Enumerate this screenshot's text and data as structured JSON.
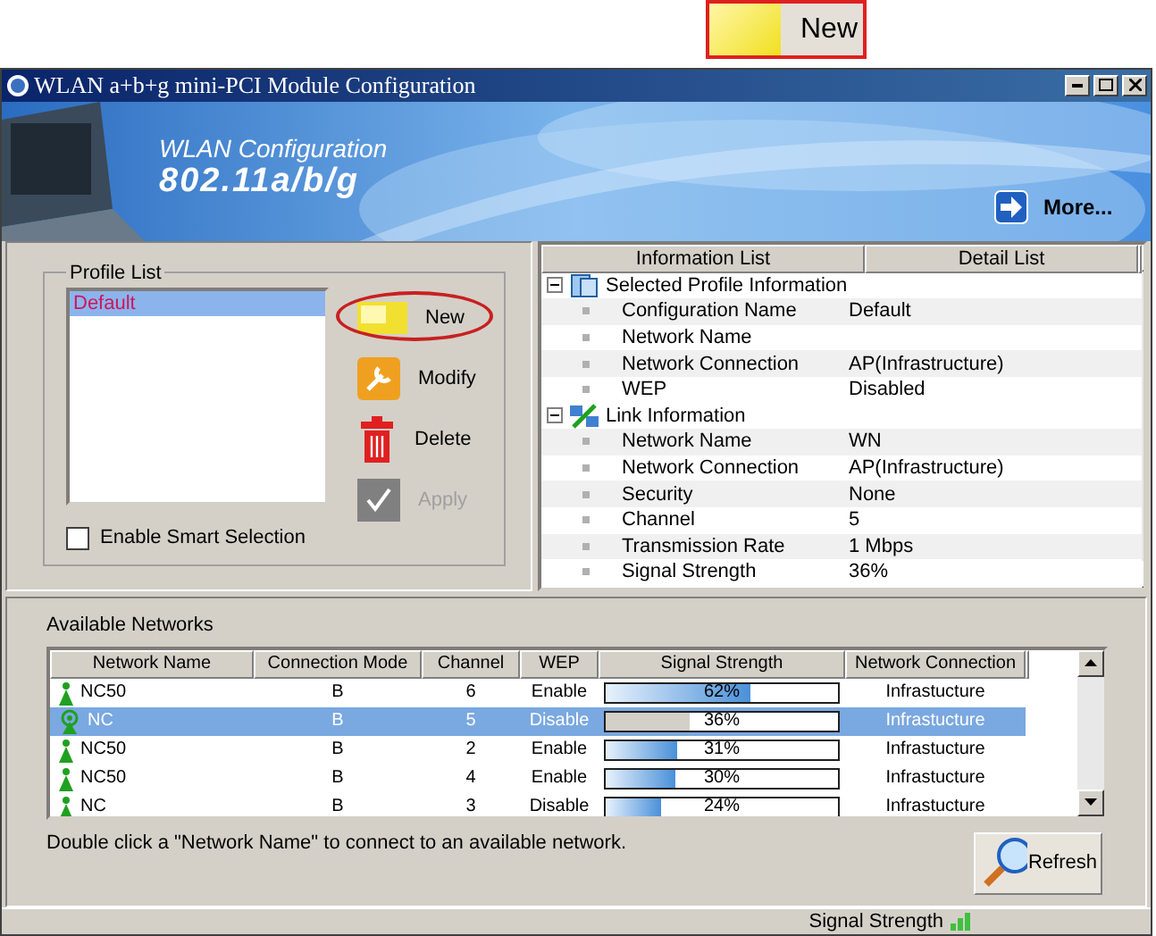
{
  "callout": {
    "label": "New"
  },
  "window": {
    "title": "WLAN a+b+g mini-PCI Module Configuration"
  },
  "banner": {
    "title": "WLAN Configuration",
    "subtitle": "802.11a/b/g",
    "more": "More..."
  },
  "profile_list": {
    "legend": "Profile List",
    "profiles": [
      {
        "name": "Default",
        "selected": true
      }
    ],
    "buttons": [
      {
        "label": "New",
        "kind": "new",
        "disabled": false,
        "highlighted": true
      },
      {
        "label": "Modify",
        "kind": "modify",
        "disabled": false,
        "highlighted": false
      },
      {
        "label": "Delete",
        "kind": "delete",
        "disabled": false,
        "highlighted": false
      },
      {
        "label": "Apply",
        "kind": "apply",
        "disabled": true,
        "highlighted": false
      }
    ],
    "smart_selection": {
      "label": "Enable Smart Selection",
      "checked": false
    }
  },
  "info": {
    "columns": [
      "Information List",
      "Detail List"
    ],
    "sections": [
      {
        "title": "Selected Profile Information",
        "kind": "profile",
        "expanded": true,
        "items": [
          {
            "label": "Configuration Name",
            "value": "Default"
          },
          {
            "label": "Network Name"
          },
          {
            "label": "Network Connection",
            "value": "AP(Infrastructure)"
          },
          {
            "label": "WEP",
            "value": "Disabled"
          }
        ]
      },
      {
        "title": "Link Information",
        "kind": "link",
        "expanded": true,
        "items": [
          {
            "label": "Network Name",
            "value": "WN"
          },
          {
            "label": "Network Connection",
            "value": "AP(Infrastructure)"
          },
          {
            "label": "Security",
            "value": "None"
          },
          {
            "label": "Channel",
            "value": "5"
          },
          {
            "label": "Transmission Rate",
            "value": "1 Mbps"
          },
          {
            "label": "Signal Strength",
            "value": "36%"
          }
        ]
      }
    ]
  },
  "networks": {
    "legend": "Available Networks",
    "columns": [
      "Network Name",
      "Connection Mode",
      "Channel",
      "WEP",
      "Signal Strength",
      "Network Connection"
    ],
    "rows": [
      {
        "name": "NC50",
        "kind": "available",
        "mode": "B",
        "channel": "6",
        "wep": "Enable",
        "level": 0.62,
        "reading": "62%",
        "connection": "Infrastucture",
        "selected": false
      },
      {
        "name": "NC",
        "kind": "connected",
        "mode": "B",
        "channel": "5",
        "wep": "Disable",
        "level": 0.36,
        "reading": "36%",
        "connection": "Infrastucture",
        "selected": true
      },
      {
        "name": "NC50",
        "kind": "available",
        "mode": "B",
        "channel": "2",
        "wep": "Enable",
        "level": 0.31,
        "reading": "31%",
        "connection": "Infrastucture",
        "selected": false
      },
      {
        "name": "NC50",
        "kind": "available",
        "mode": "B",
        "channel": "4",
        "wep": "Enable",
        "level": 0.3,
        "reading": "30%",
        "connection": "Infrastucture",
        "selected": false
      },
      {
        "name": "NC",
        "kind": "available",
        "mode": "B",
        "channel": "3",
        "wep": "Disable",
        "level": 0.24,
        "reading": "24%",
        "connection": "Infrastucture",
        "selected": false
      }
    ],
    "hint": "Double click a \"Network Name\" to connect to an available network.",
    "refresh": "Refresh"
  },
  "status_bar": {
    "label": "Signal Strength"
  }
}
